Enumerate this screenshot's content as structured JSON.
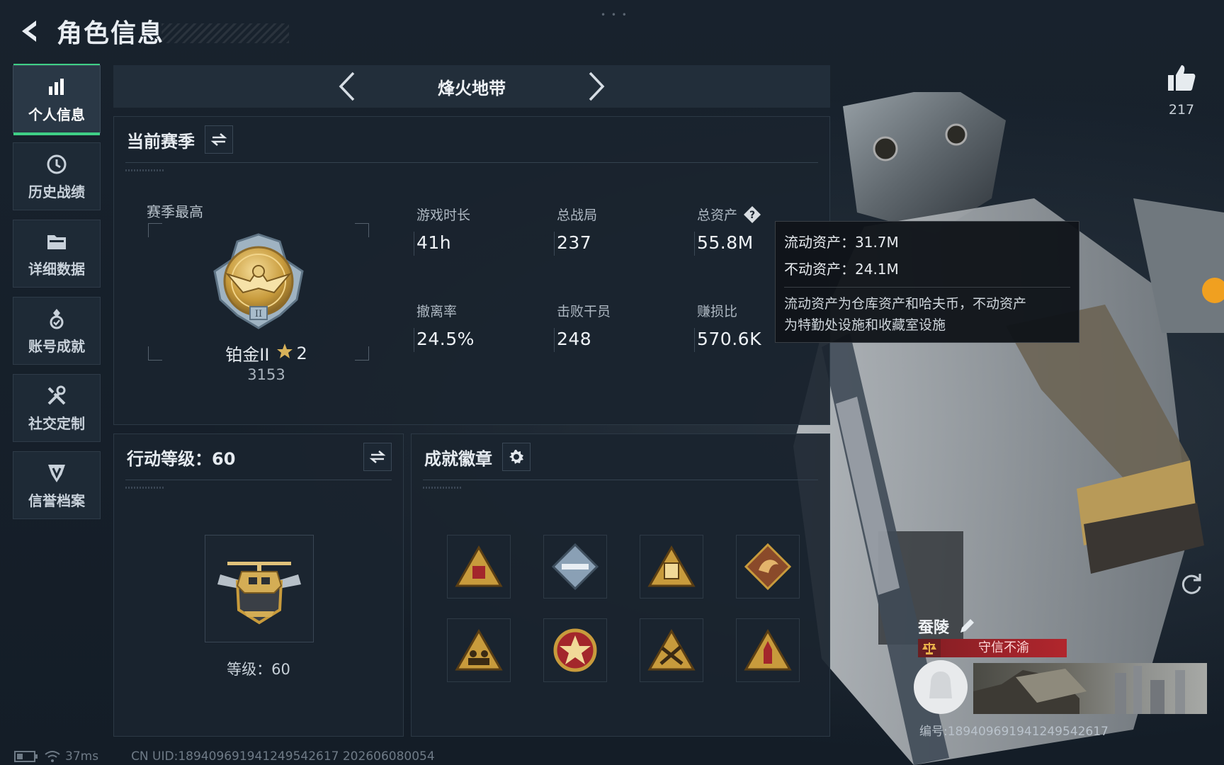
{
  "header": {
    "title": "角色信息"
  },
  "sidebar": {
    "items": [
      {
        "label": "个人信息",
        "icon": "bar-chart-icon",
        "active": true
      },
      {
        "label": "历史战绩",
        "icon": "history-clock-icon",
        "active": false
      },
      {
        "label": "详细数据",
        "icon": "folder-icon",
        "active": false
      },
      {
        "label": "账号成就",
        "icon": "achievement-medal-icon",
        "active": false
      },
      {
        "label": "社交定制",
        "icon": "tools-icon",
        "active": false
      },
      {
        "label": "信誉档案",
        "icon": "credit-shield-icon",
        "active": false
      }
    ]
  },
  "mode": {
    "title": "烽火地带"
  },
  "season": {
    "title": "当前赛季",
    "best_label": "赛季最高",
    "rank": "铂金II",
    "stars": "2",
    "score": "3153",
    "stats": [
      {
        "label": "游戏时长",
        "value": "41h"
      },
      {
        "label": "总战局",
        "value": "237"
      },
      {
        "label": "总资产",
        "value": "55.8M"
      },
      {
        "label": "撤离率",
        "value": "24.5%"
      },
      {
        "label": "击败干员",
        "value": "248"
      },
      {
        "label": "赚损比",
        "value": "570.6K"
      }
    ]
  },
  "tooltip": {
    "liquid": "流动资产：31.7M",
    "fixed": "不动资产：24.1M",
    "desc_line1": "流动资产为仓库资产和哈夫币，不动资产",
    "desc_line2": "为特勤处设施和收藏室设施"
  },
  "action_level": {
    "title": "行动等级：60",
    "level_text": "等级：60"
  },
  "achievements": {
    "title": "成就徽章"
  },
  "profile": {
    "likes": "217",
    "name": "蚕陵",
    "credit": "守信不渝",
    "id_text": "编号:189409691941249542617"
  },
  "footer": {
    "ping": "37ms",
    "uid": "CN UID:189409691941249542617  202606080054"
  },
  "colors": {
    "accent_green": "#3fcf86",
    "credit_red": "#b1262d",
    "badge_gold": "#c89b3c"
  }
}
